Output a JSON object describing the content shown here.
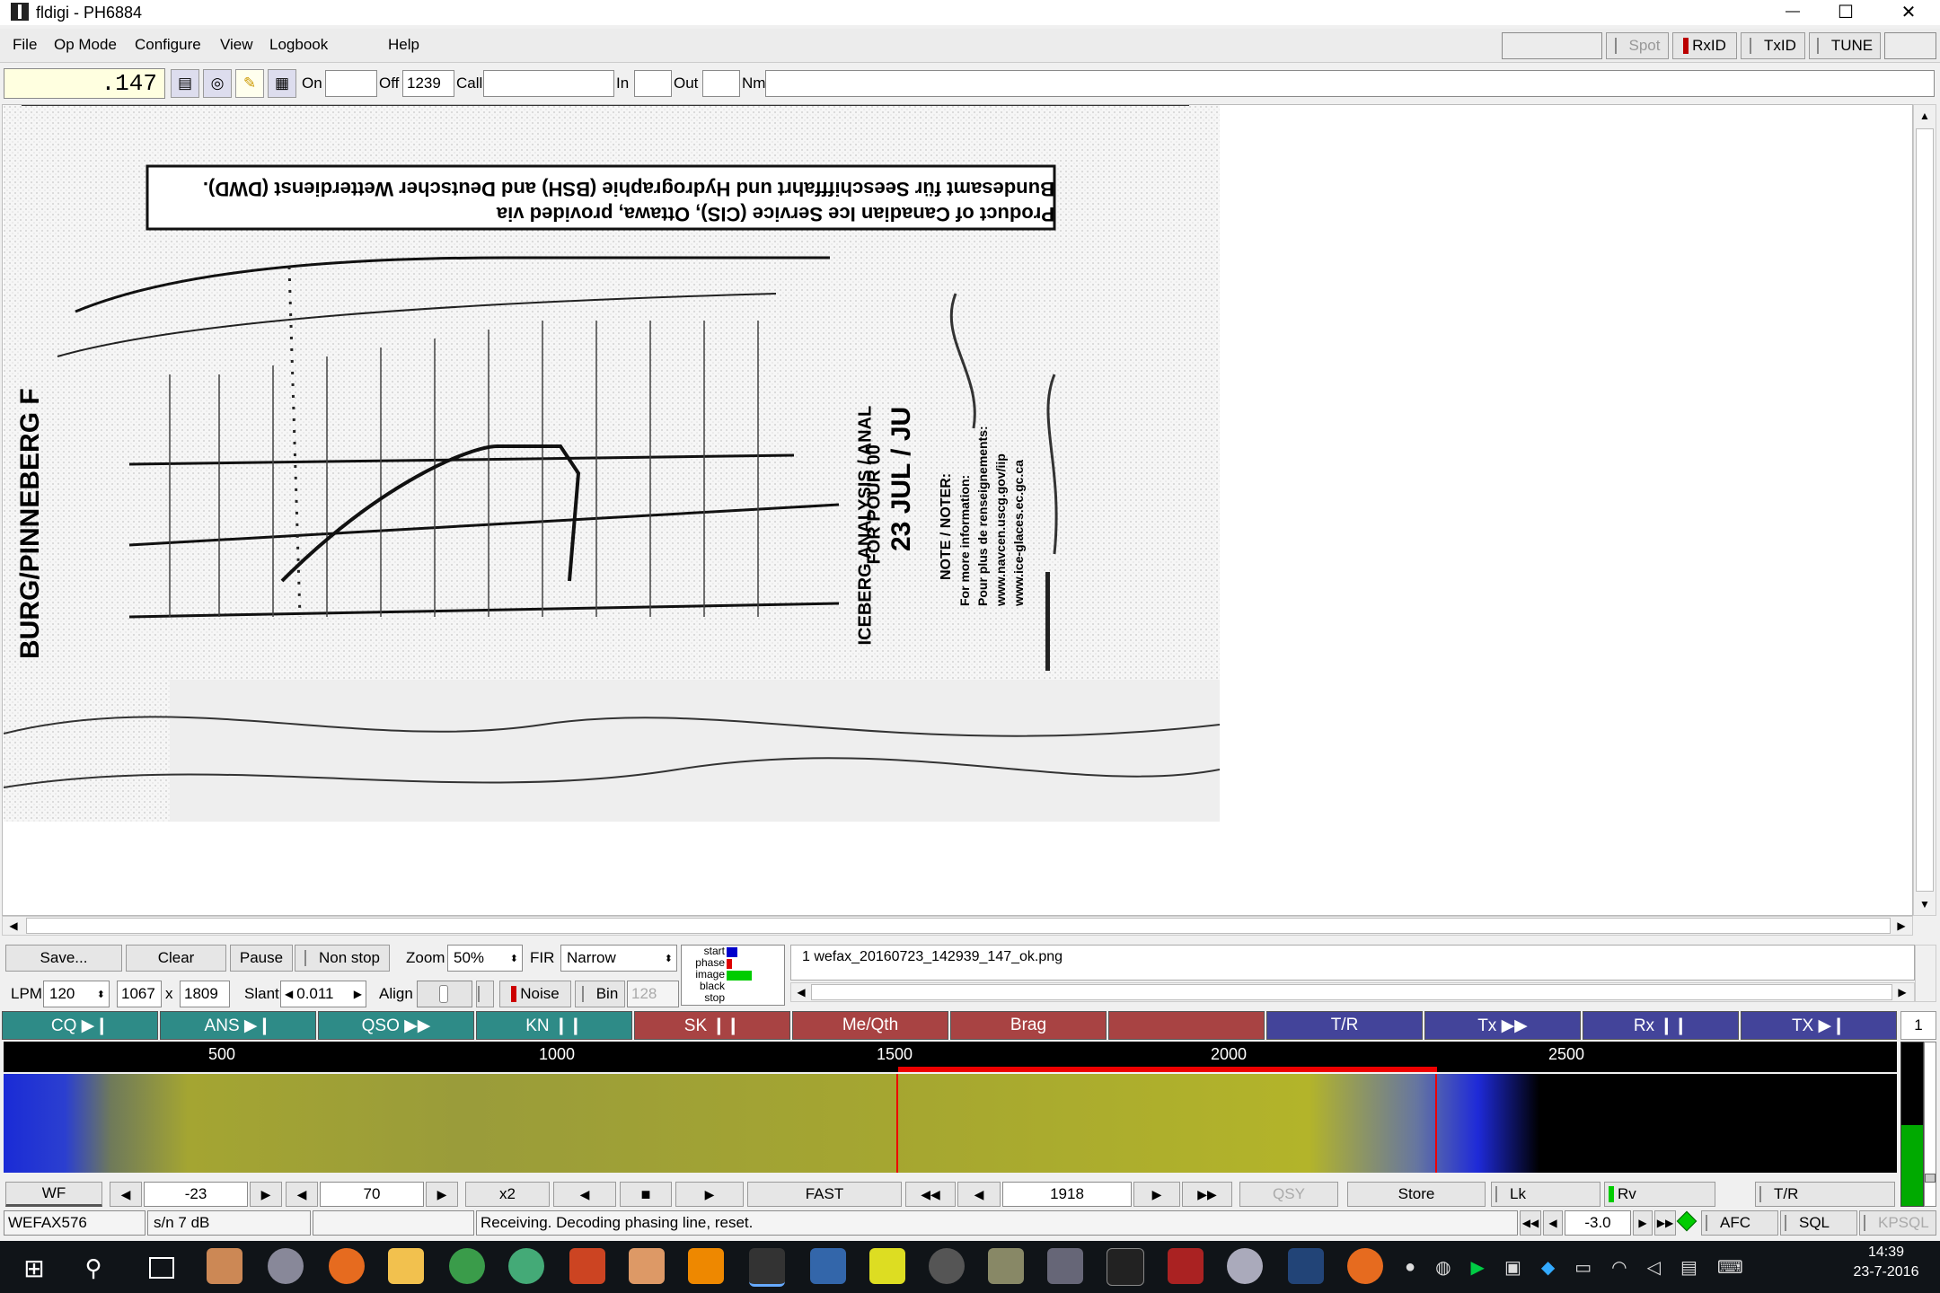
{
  "window": {
    "title": "fldigi - PH6884",
    "minimize": "—",
    "maximize": "☐",
    "close": "✕"
  },
  "menu": [
    "File",
    "Op Mode",
    "Configure",
    "View",
    "Logbook",
    "Help"
  ],
  "menu_right": {
    "spot": "Spot",
    "rxid": "RxID",
    "txid": "TxID",
    "tune": "TUNE"
  },
  "qso_bar": {
    "freq": ".147",
    "on_label": "On",
    "on_value": "",
    "off_label": "Off",
    "off_value": "1239",
    "call_label": "Call",
    "call_value": "",
    "in_label": "In",
    "in_value": "",
    "out_label": "Out",
    "out_value": "",
    "nm_label": "Nm",
    "nm_value": ""
  },
  "fax_controls": {
    "save": "Save...",
    "clear": "Clear",
    "pause": "Pause",
    "non_stop": "Non stop",
    "zoom_label": "Zoom",
    "zoom_value": "50%",
    "fir_label": "FIR",
    "fir_value": "Narrow",
    "lpm_label": "LPM",
    "lpm_value": "120",
    "width": "1067",
    "x": "x",
    "height": "1809",
    "slant_label": "Slant",
    "slant_value": "0.011",
    "align_label": "Align",
    "noise": "Noise",
    "bin": "Bin",
    "bin_value": "128",
    "state_labels": [
      "start",
      "phase",
      "image",
      "black",
      "stop"
    ],
    "filename": "1 wefax_20160723_142939_147_ok.png"
  },
  "macros": [
    {
      "label": "CQ ▶❙",
      "color": "#2e8b87"
    },
    {
      "label": "ANS ▶❙",
      "color": "#2e8b87"
    },
    {
      "label": "QSO ▶▶",
      "color": "#2e8b87"
    },
    {
      "label": "KN ❙❙",
      "color": "#2e8b87"
    },
    {
      "label": "SK ❙❙",
      "color": "#a84343"
    },
    {
      "label": "Me/Qth",
      "color": "#a84343"
    },
    {
      "label": "Brag",
      "color": "#a84343"
    },
    {
      "label": "",
      "color": "#a84343"
    },
    {
      "label": "T/R",
      "color": "#43449a"
    },
    {
      "label": "Tx ▶▶",
      "color": "#43449a"
    },
    {
      "label": "Rx ❙❙",
      "color": "#43449a"
    },
    {
      "label": "TX ▶❙",
      "color": "#43449a"
    }
  ],
  "macro_set": "1",
  "waterfall": {
    "scale": [
      "500",
      "1000",
      "1500",
      "2000",
      "2500"
    ]
  },
  "wf_controls": {
    "wf": "WF",
    "ref": "-23",
    "range": "70",
    "rate": "x2",
    "speed": "FAST",
    "carrier": "1918",
    "qsy": "QSY",
    "store": "Store",
    "lk": "Lk",
    "rv": "Rv",
    "tr": "T/R"
  },
  "status": {
    "mode": "WEFAX576",
    "sn": "s/n   7 dB",
    "empty": "",
    "message": "Receiving. Decoding phasing line, reset.",
    "offset": "-3.0",
    "afc": "AFC",
    "sql": "SQL",
    "kpsql": "KPSQL"
  },
  "fax_text": {
    "line1": "Bundesamt für Seeschifffahrt und Hydrographie (BSH) and Deutscher Wetterdienst (DWD).",
    "line2": "Product of Canadian Ice Service (CIS), Ottawa, provided via",
    "side1": "ICEBERG ANALYSIS / ANAL",
    "side2": "FOR POUR 00",
    "side3": "23 JUL / JU",
    "note": "NOTE / NOTER:",
    "info": "For more information:",
    "info2": "Pour plus de renseignements:",
    "url1": "www.navcen.uscg.gov/iip",
    "url2": "www.ice-glaces.ec.gc.ca",
    "left": "BURG/PINNEBERG F"
  },
  "taskbar": {
    "time": "14:39",
    "date": "23-7-2016"
  }
}
